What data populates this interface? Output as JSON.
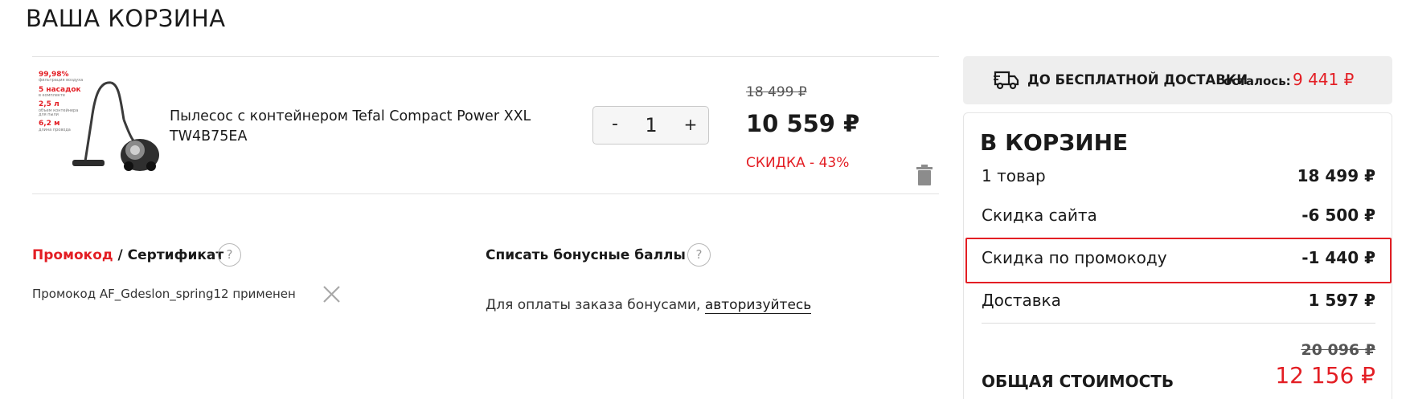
{
  "page": {
    "title": "ВАША КОРЗИНА"
  },
  "item": {
    "image_promo": [
      {
        "value": "99,98%",
        "sub": "фильтрация воздуха"
      },
      {
        "value": "5 насадок",
        "sub": "в комплекте"
      },
      {
        "value": "2,5 л",
        "sub": "объем контейнера для пыли"
      },
      {
        "value": "6,2 м",
        "sub": "длина провода"
      }
    ],
    "name": "Пылесос с контейнером Tefal Compact Power XXL TW4B75EA",
    "quantity": "1",
    "minus_label": "-",
    "plus_label": "+",
    "old_price": "18 499 ₽",
    "price": "10 559 ₽",
    "discount": "СКИДКА - 43%",
    "icons": {
      "remove": "trash-icon"
    }
  },
  "promo": {
    "promo_link": "Промокод",
    "separator": " / ",
    "certificate_label": "Сертификат",
    "help_label": "?",
    "applied_text": "Промокод AF_Gdeslon_spring12 применен",
    "icons": {
      "remove": "close-icon",
      "help": "question-icon"
    }
  },
  "bonus": {
    "title": "Списать бонусные баллы",
    "help_label": "?",
    "text": "Для оплаты заказа бонусами, ",
    "link": "авторизуйтесь"
  },
  "delivery": {
    "text": "ДО БЕСПЛАТНОЙ ДОСТАВКИ",
    "remaining_label": "осталось:",
    "remaining_amount": "9 441 ₽",
    "icon": "truck-icon"
  },
  "summary": {
    "title": "В КОРЗИНЕ",
    "rows": [
      {
        "label": "1 товар",
        "value": "18 499 ₽"
      },
      {
        "label": "Скидка сайта",
        "value": "-6 500 ₽"
      },
      {
        "label": "Скидка по промокоду",
        "value": "-1 440 ₽"
      },
      {
        "label": "Доставка",
        "value": "1 597 ₽"
      }
    ],
    "total_old": "20 096 ₽",
    "total_label": "ОБЩАЯ СТОИМОСТЬ",
    "total_new": "12 156 ₽"
  },
  "colors": {
    "accent_red": "#e31e24",
    "panel_gray": "#eeeeee",
    "text_dark": "#1a1a1a"
  }
}
